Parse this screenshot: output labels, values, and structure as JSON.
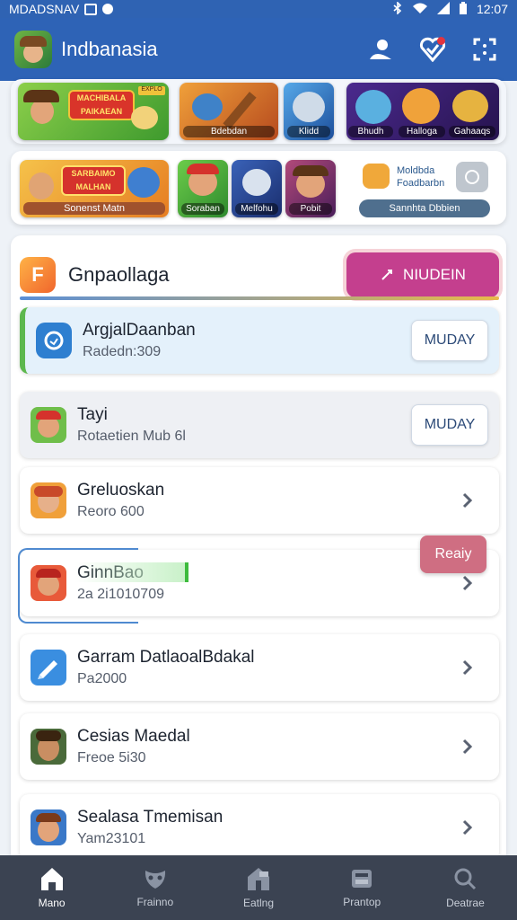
{
  "status": {
    "carrier": "MDADSNAV",
    "time": "12:07"
  },
  "header": {
    "title": "Indbanasia"
  },
  "banner_top": {
    "captions": [
      "",
      "Bdebdan",
      "Klidd",
      "Bhudh",
      "Halloga",
      "Gahaaqs"
    ],
    "hero_title": "MACHIBALA\nPAIKAEAN",
    "hero_badge": "EXPLO"
  },
  "banner_bottom": {
    "hero_title": "SARBAIMO\nMALHAN",
    "hero_caption": "Sonenst Matn",
    "tile_captions": [
      "Soraban",
      "Melfohu",
      "Pobit"
    ],
    "promo_line1": "Moldbda",
    "promo_line2": "Foadbarbn",
    "promo_button": "Sannhta Dbbien"
  },
  "section": {
    "title": "Gnpaollaga",
    "action": "NIUDEIN"
  },
  "list": [
    {
      "name": "ArgjalDaanban",
      "sub": "Radedn:309",
      "button": "MUDAY"
    },
    {
      "name": "Tayi",
      "sub": "Rotaetien Mub 6l",
      "button": "MUDAY"
    },
    {
      "name": "Greluoskan",
      "sub": "Reoro 600"
    },
    {
      "name": "GinnBao",
      "sub": "2a 2i1010709"
    },
    {
      "name": "Garram DatlaoalBdakal",
      "sub": "Pa2000"
    },
    {
      "name": "Cesias Maedal",
      "sub": "Freoe 5i30"
    },
    {
      "name": "Sealasa Tmemisan",
      "sub": "Yam23101"
    }
  ],
  "ready_label": "Reaiy",
  "nav": [
    {
      "label": "Mano",
      "icon": "home-icon"
    },
    {
      "label": "Frainno",
      "icon": "mask-icon"
    },
    {
      "label": "Eatlng",
      "icon": "store-icon"
    },
    {
      "label": "Prantop",
      "icon": "inbox-icon"
    },
    {
      "label": "Deatrae",
      "icon": "search-icon"
    }
  ],
  "colors": {
    "appbar": "#2e63b6",
    "accent": "#c43f8e",
    "navbar": "#3b4352"
  }
}
